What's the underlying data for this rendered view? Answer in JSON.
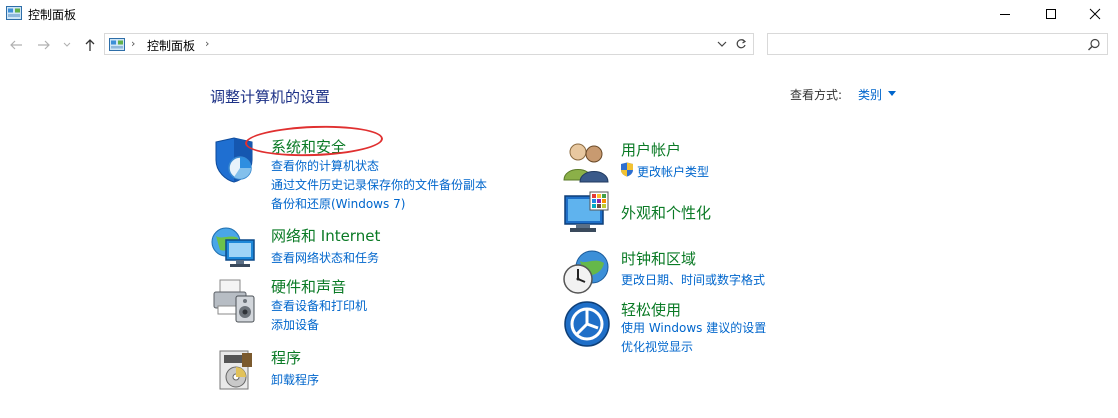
{
  "window": {
    "title": "控制面板",
    "controls": [
      "minimize-icon",
      "maximize-icon",
      "close-icon"
    ]
  },
  "nav": {
    "breadcrumb": [
      "控制面板"
    ],
    "search_placeholder": ""
  },
  "main": {
    "heading": "调整计算机的设置",
    "view_by_label": "查看方式:",
    "view_by_value": "类别"
  },
  "categories_left": [
    {
      "title": "系统和安全",
      "icon": "shield-icon",
      "links": [
        "查看你的计算机状态",
        "通过文件历史记录保存你的文件备份副本",
        "备份和还原(Windows 7)"
      ]
    },
    {
      "title": "网络和 Internet",
      "icon": "network-icon",
      "links": [
        "查看网络状态和任务"
      ]
    },
    {
      "title": "硬件和声音",
      "icon": "printer-icon",
      "links": [
        "查看设备和打印机",
        "添加设备"
      ]
    },
    {
      "title": "程序",
      "icon": "programs-icon",
      "links": [
        "卸载程序"
      ]
    }
  ],
  "categories_right": [
    {
      "title": "用户帐户",
      "icon": "users-icon",
      "links": [
        "更改帐户类型"
      ]
    },
    {
      "title": "外观和个性化",
      "icon": "monitor-icon",
      "links": []
    },
    {
      "title": "时钟和区域",
      "icon": "clock-globe-icon",
      "links": [
        "更改日期、时间或数字格式"
      ]
    },
    {
      "title": "轻松使用",
      "icon": "ease-of-access-icon",
      "links": [
        "使用 Windows 建议的设置",
        "优化视觉显示"
      ]
    }
  ],
  "colors": {
    "heading": "#1e3287",
    "category_title": "#0a7a25",
    "link": "#0066cc",
    "annotation": "#e03030"
  }
}
